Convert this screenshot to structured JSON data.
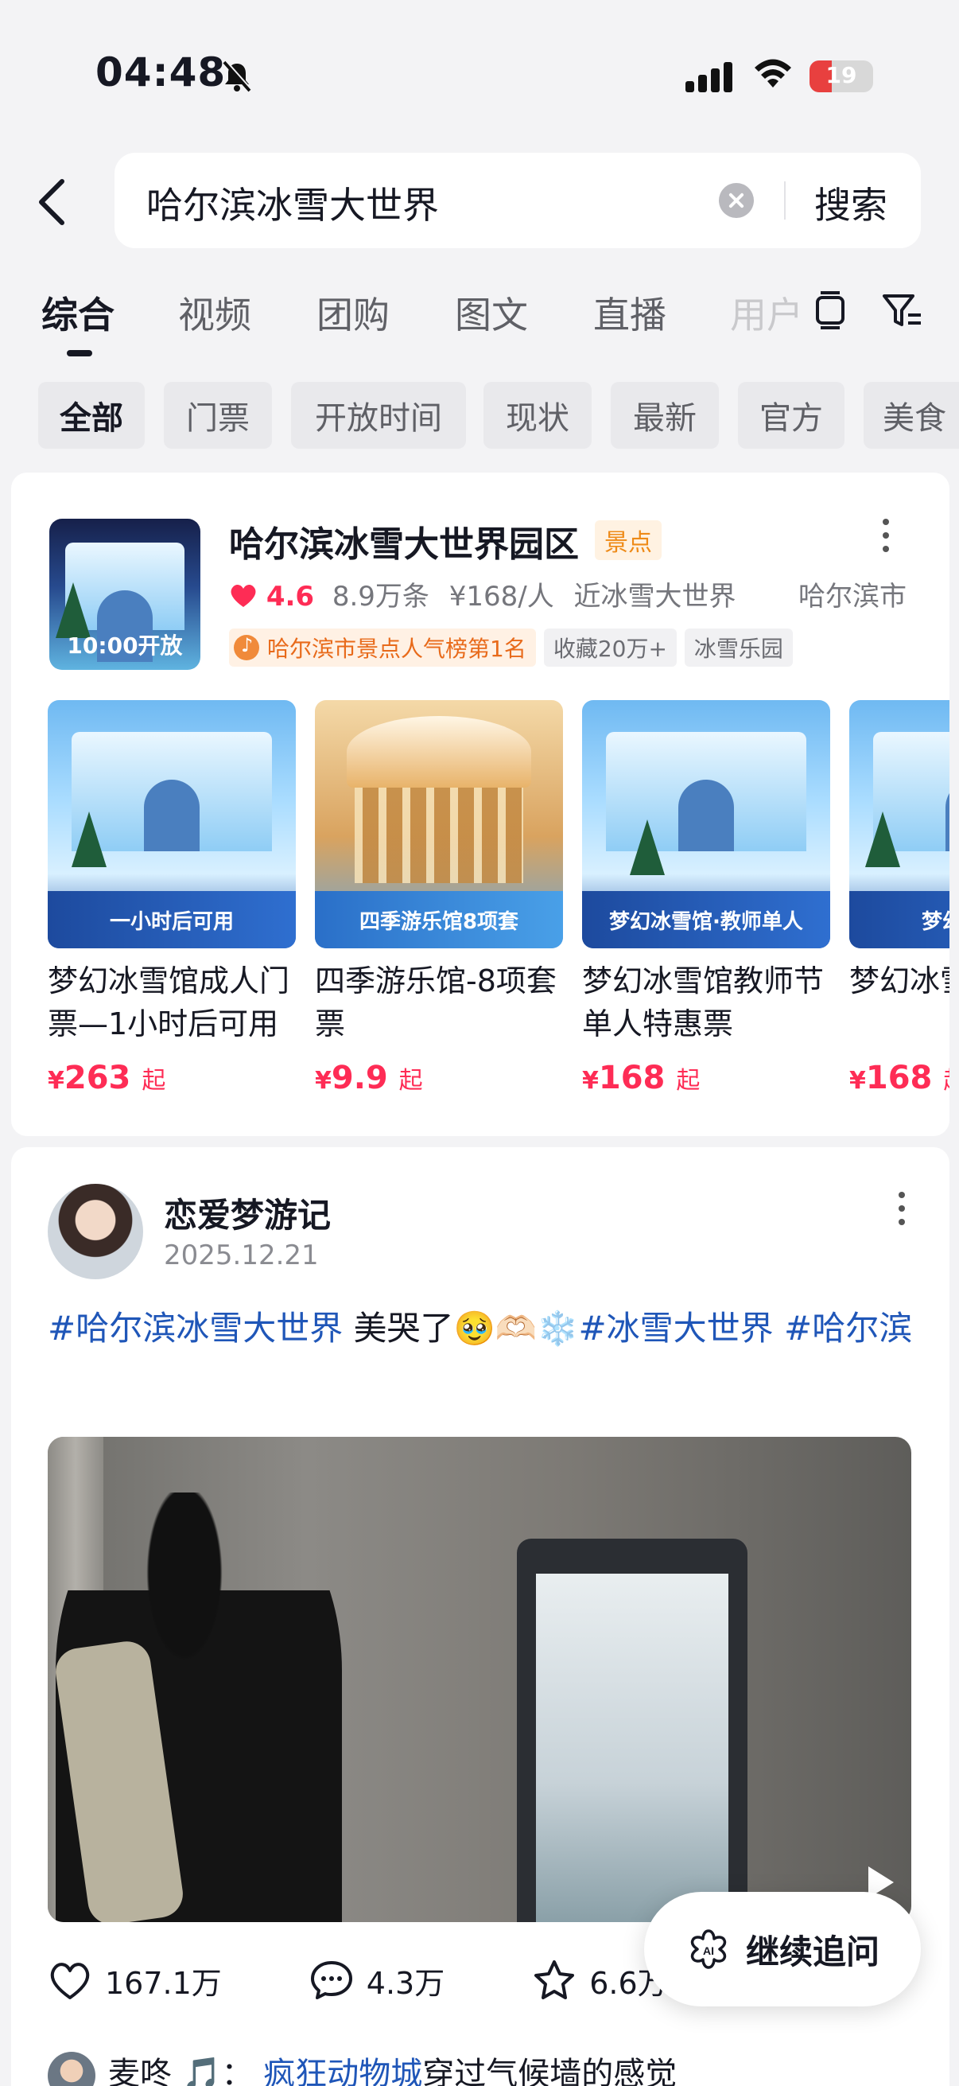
{
  "status_bar": {
    "time": "04:48",
    "battery": "19"
  },
  "search": {
    "query": "哈尔滨冰雪大世界",
    "button": "搜索"
  },
  "tabs": [
    "综合",
    "视频",
    "团购",
    "图文",
    "直播",
    "用户"
  ],
  "chips": [
    "全部",
    "门票",
    "开放时间",
    "现状",
    "最新",
    "官方",
    "美食"
  ],
  "poi": {
    "thumb_label": "10:00开放",
    "title": "哈尔滨冰雪大世界园区",
    "tag": "景点",
    "rating": "4.6",
    "reviews": "8.9万条",
    "price": "¥168/人",
    "nearby": "近冰雪大世界",
    "city": "哈尔滨市",
    "rank_badge": "哈尔滨市景点人气榜第1名",
    "badge_fav": "收藏20万+",
    "badge_type": "冰雪乐园"
  },
  "products": [
    {
      "name": "梦幻冰雪馆成人门票—1小时后可用",
      "price": "263",
      "banner": "一小时后可用"
    },
    {
      "name": "四季游乐馆-8项套票",
      "price": "9.9",
      "banner": "四季游乐馆8项套"
    },
    {
      "name": "梦幻冰雪馆教师节单人特惠票",
      "price": "168",
      "banner": "梦幻冰雪馆·教师单人"
    },
    {
      "name": "梦幻冰雪馆居民票",
      "price": "168",
      "banner": "梦幻冰雪馆"
    }
  ],
  "price_suffix": "起",
  "currency": "¥",
  "post": {
    "author": "恋爱梦游记",
    "date": "2025.12.21",
    "hashtag1": "#哈尔滨冰雪大世界",
    "text_mid": " 美哭了🥹🫶🏻❄️",
    "hashtag2": "#冰雪大世界",
    "hashtag3": " #哈尔滨",
    "likes": "167.1万",
    "comments": "4.3万",
    "favorites": "6.6万"
  },
  "followup": "继续追问",
  "bottom": {
    "user": "麦咚",
    "link": "疯狂动物城",
    "text": "穿过气候墙的感觉"
  },
  "colors": {
    "accent_red": "#fe2c55",
    "link_blue": "#1f56b8",
    "tag_orange": "#ee8a17"
  }
}
